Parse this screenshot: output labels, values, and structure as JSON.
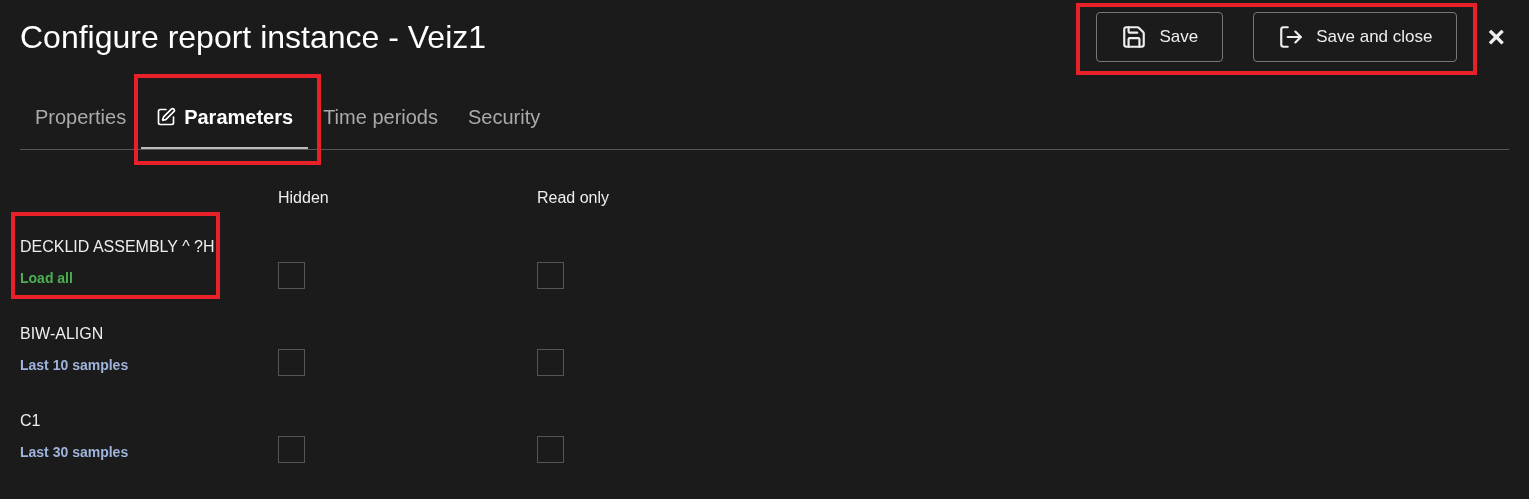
{
  "title": "Configure report instance - Veiz1",
  "actions": {
    "highlighted": true,
    "buttons": [
      {
        "kind": "save",
        "label": "Save"
      },
      {
        "kind": "save_close",
        "label": "Save and close"
      }
    ]
  },
  "close": {
    "label": "×"
  },
  "tabs": [
    {
      "label": "Properties",
      "selected": false,
      "highlighted": false
    },
    {
      "label": "Parameters",
      "selected": true,
      "highlighted": true
    },
    {
      "label": "Time periods",
      "selected": false,
      "highlighted": false
    },
    {
      "label": "Security",
      "selected": false,
      "highlighted": false
    }
  ],
  "columns": [
    "Hidden",
    "Read only"
  ],
  "parameters": [
    {
      "name": "DECKLID ASSEMBLY ^ ?H",
      "mode": "Load all",
      "color": "#4caf50",
      "hidden": false,
      "read_only": false,
      "highlighted": true
    },
    {
      "name": "BIW-ALIGN",
      "mode": "Last 10 samples",
      "color": "#9fb3dc",
      "hidden": false,
      "read_only": false,
      "highlighted": false
    },
    {
      "name": "C1",
      "mode": "Last 30 samples",
      "color": "#9fb3dc",
      "hidden": false,
      "read_only": false,
      "highlighted": false
    }
  ]
}
